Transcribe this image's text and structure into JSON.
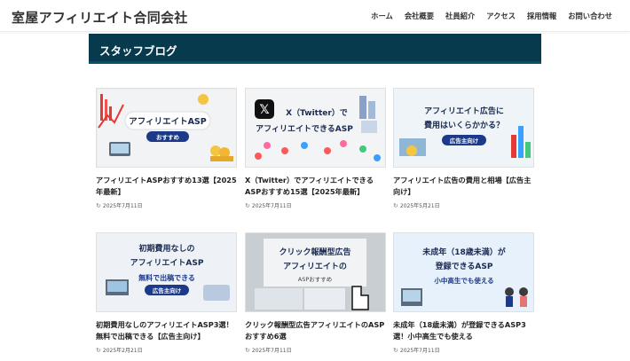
{
  "site": {
    "title": "室屋アフィリエイト合同会社"
  },
  "nav": [
    "ホーム",
    "会社概要",
    "社員紹介",
    "アクセス",
    "採用情報",
    "お問い合わせ"
  ],
  "section": {
    "title": "スタッフブログ"
  },
  "icons": {
    "date": "refresh-icon"
  },
  "colors": {
    "header_bar": "#073a4d",
    "badge": "#1d3a8a"
  },
  "posts": [
    {
      "title": "アフィリエイトASPおすすめ13選【2025年最新】",
      "date": "2025年7月11日",
      "thumb": {
        "line1": "アフィリエイトASP",
        "line2": "",
        "badge": "おすすめ"
      }
    },
    {
      "title": "X（Twitter）でアフィリエイトできるASPおすすめ15選【2025年最新】",
      "date": "2025年7月11日",
      "thumb": {
        "line1": "X（Twitter）で",
        "line2": "アフィリエイトできるASP",
        "badge": ""
      }
    },
    {
      "title": "アフィリエイト広告の費用と相場【広告主向け】",
      "date": "2025年5月21日",
      "thumb": {
        "line1": "アフィリエイト広告に",
        "line2": "費用はいくらかかる？",
        "badge": "広告主向け"
      }
    },
    {
      "title": "初期費用なしのアフィリエイトASP3選！無料で出稿できる【広告主向け】",
      "date": "2025年2月21日",
      "thumb": {
        "line1": "初期費用なしの",
        "line2": "アフィリエイトASP",
        "line3": "無料で出稿できる",
        "badge": "広告主向け"
      }
    },
    {
      "title": "クリック報酬型広告アフィリエイトのASPおすすめ6選",
      "date": "2025年7月11日",
      "thumb": {
        "line1": "クリック報酬型広告",
        "line2": "アフィリエイトの",
        "line3": "ASPおすすめ",
        "badge": ""
      }
    },
    {
      "title": "未成年（18歳未満）が登録できるASP3選！小中高生でも使える",
      "date": "2025年7月11日",
      "thumb": {
        "line1": "未成年（18歳未満）が",
        "line2": "登録できるASP",
        "line3": "小中高生でも使える",
        "badge": ""
      }
    }
  ]
}
